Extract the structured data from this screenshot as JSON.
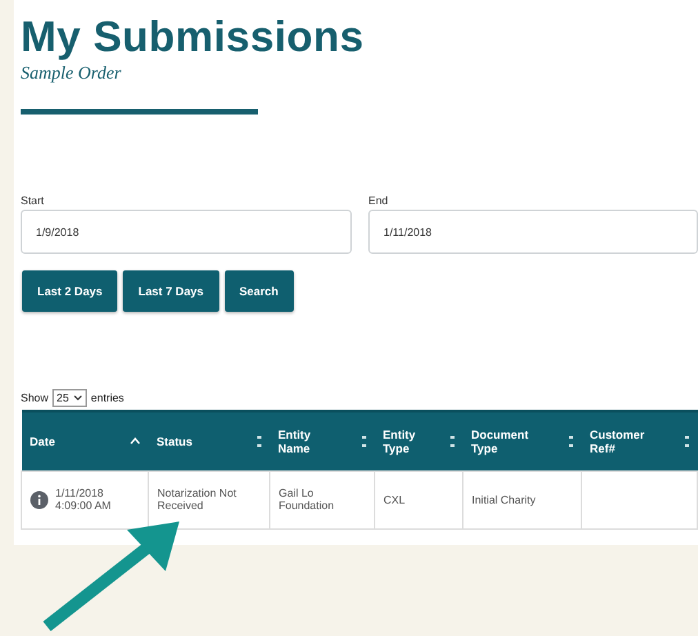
{
  "title": "My Submissions",
  "subtitle": "Sample Order",
  "filters": [
    {
      "label": "Start",
      "value": "1/9/2018"
    },
    {
      "label": "End",
      "value": "1/11/2018"
    }
  ],
  "buttons": [
    "Last 2 Days",
    "Last 7 Days",
    "Search"
  ],
  "page_length": {
    "before": "Show",
    "value": "25",
    "after": "entries"
  },
  "table": {
    "columns": [
      {
        "label": "Date",
        "sorted": true
      },
      {
        "label": "Status",
        "sorted": false
      },
      {
        "label": "Entity Name",
        "sorted": false
      },
      {
        "label": "Entity Type",
        "sorted": false
      },
      {
        "label": "Document Type",
        "sorted": false
      },
      {
        "label": "Customer Ref#",
        "sorted": false
      }
    ],
    "rows": [
      {
        "cells": [
          "1/11/2018 4:09:00 AM",
          "Notarization Not Received",
          "Gail Lo Foundation",
          "CXL",
          "Initial Charity",
          ""
        ]
      }
    ]
  }
}
